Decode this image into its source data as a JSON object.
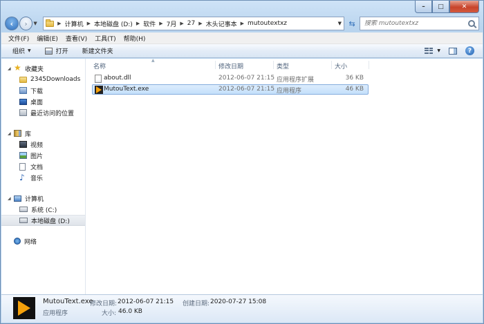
{
  "window": {
    "controls": {
      "minimize": "–",
      "maximize": "□",
      "close": "✕"
    }
  },
  "address": {
    "crumbs": [
      "计算机",
      "本地磁盘 (D:)",
      "软件",
      "7月",
      "27",
      "木头记事本",
      "mutoutextxz"
    ],
    "search_placeholder": "搜索 mutoutextxz"
  },
  "menu": [
    "文件(F)",
    "编辑(E)",
    "查看(V)",
    "工具(T)",
    "帮助(H)"
  ],
  "commands": {
    "organize": "组织",
    "print": "打开",
    "new_folder": "新建文件夹"
  },
  "nav": {
    "favorites": {
      "title": "收藏夹",
      "items": [
        "2345Downloads",
        "下载",
        "桌面",
        "最近访问的位置"
      ]
    },
    "libraries": {
      "title": "库",
      "items": [
        "视频",
        "图片",
        "文档",
        "音乐"
      ]
    },
    "computer": {
      "title": "计算机",
      "items": [
        "系统 (C:)",
        "本地磁盘 (D:)"
      ]
    },
    "network": {
      "title": "网络"
    }
  },
  "columns": {
    "name": "名称",
    "modified": "修改日期",
    "type": "类型",
    "size": "大小"
  },
  "files": [
    {
      "name": "about.dll",
      "modified": "2012-06-07 21:15",
      "type": "应用程序扩展",
      "size": "36 KB",
      "icon": "dll-file-icon"
    },
    {
      "name": "MutouText.exe",
      "modified": "2012-06-07 21:15",
      "type": "应用程序",
      "size": "46 KB",
      "icon": "exe-file-icon",
      "selected": true
    }
  ],
  "details": {
    "name": "MutouText.exe",
    "type": "应用程序",
    "modified_label": "修改日期:",
    "modified": "2012-06-07 21:15",
    "created_label": "创建日期:",
    "created": "2020-07-27 15:08",
    "size_label": "大小:",
    "size": "46.0 KB"
  },
  "colors": {
    "accent": "#2e6fbd",
    "selection": "#c4e0fb",
    "close": "#c8442b"
  }
}
